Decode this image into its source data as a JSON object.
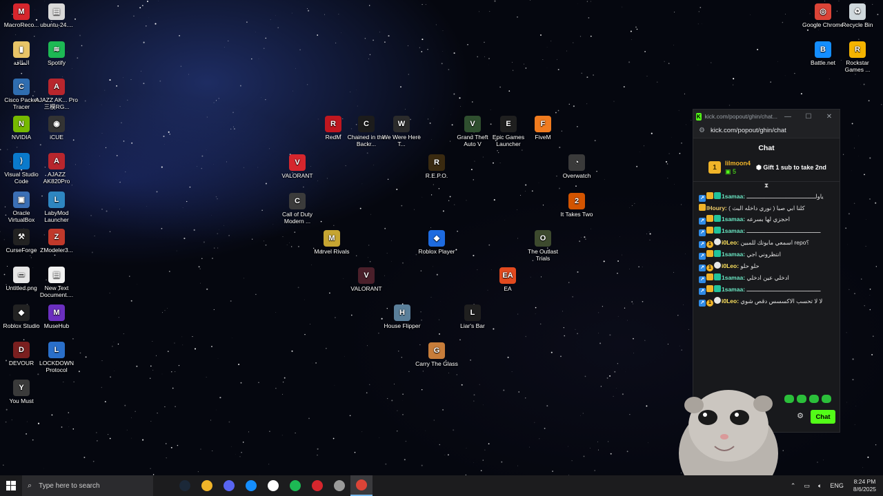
{
  "desktop_icons": [
    {
      "label": "MacroReco...",
      "color": "#d6262d",
      "glyph": "M"
    },
    {
      "label": "ubuntu-24....",
      "color": "#d9d9d9",
      "glyph": "▤"
    },
    {
      "label": "الطاقة",
      "color": "#e8c467",
      "glyph": "▮"
    },
    {
      "label": "Spotify",
      "color": "#1db954",
      "glyph": "≋"
    },
    {
      "label": "Cisco Packet Tracer",
      "color": "#2f6db0",
      "glyph": "C"
    },
    {
      "label": "AJAZZ AK... Pro三模RG...",
      "color": "#b8262d",
      "glyph": "A"
    },
    {
      "label": "NVIDIA",
      "color": "#76b900",
      "glyph": "N"
    },
    {
      "label": "iCUE",
      "color": "#333333",
      "glyph": "◉"
    },
    {
      "label": "Visual Studio Code",
      "color": "#0a7acc",
      "glyph": "⟩"
    },
    {
      "label": "AJAZZ AK820Pro",
      "color": "#b8262d",
      "glyph": "A"
    },
    {
      "label": "Oracle VirtualBox",
      "color": "#3b6fb5",
      "glyph": "▣"
    },
    {
      "label": "LabyMod Launcher",
      "color": "#2e86c1",
      "glyph": "L"
    },
    {
      "label": "CurseForge",
      "color": "#222222",
      "glyph": "⚒"
    },
    {
      "label": "ZModeler3...",
      "color": "#c0392b",
      "glyph": "Z"
    },
    {
      "label": "Untitled.png",
      "color": "#e6e6e6",
      "glyph": "▭"
    },
    {
      "label": "New Text Document....",
      "color": "#f2f2f2",
      "glyph": "▤"
    },
    {
      "label": "Roblox Studio",
      "color": "#222222",
      "glyph": "◆"
    },
    {
      "label": "MuseHub",
      "color": "#6b2fbf",
      "glyph": "M"
    },
    {
      "label": "DEVOUR",
      "color": "#7a1f1f",
      "glyph": "D"
    },
    {
      "label": "LOCKDOWN Protocol",
      "color": "#2a6fc9",
      "glyph": "L"
    },
    {
      "label": "You Must",
      "color": "#3a3a3a",
      "glyph": "Y"
    },
    {
      "label": "Google Chrome",
      "color": "#db4437",
      "glyph": "◎"
    },
    {
      "label": "Recycle Bin",
      "color": "#cfd8dc",
      "glyph": "♻"
    },
    {
      "label": "Battle.net",
      "color": "#148eff",
      "glyph": "B"
    },
    {
      "label": "Rockstar Games ...",
      "color": "#f5b400",
      "glyph": "R"
    },
    {
      "label": "RedM",
      "color": "#c0171f",
      "glyph": "R"
    },
    {
      "label": "Chained in the Backr...",
      "color": "#1c1c1c",
      "glyph": "C"
    },
    {
      "label": "We Were Here T...",
      "color": "#2b2b2b",
      "glyph": "W"
    },
    {
      "label": "Grand Theft Auto V",
      "color": "#2f4f2f",
      "glyph": "V"
    },
    {
      "label": "Epic Games Launcher",
      "color": "#1f1f1f",
      "glyph": "E"
    },
    {
      "label": "FiveM",
      "color": "#f07b1f",
      "glyph": "F"
    },
    {
      "label": "VALORANT",
      "color": "#d6262d",
      "glyph": "V"
    },
    {
      "label": "R.E.P.O.",
      "color": "#3a2a10",
      "glyph": "R"
    },
    {
      "label": "Overwatch",
      "color": "#3a3a3a",
      "glyph": "◔"
    },
    {
      "label": "Call of Duty Modern ...",
      "color": "#3b3b3b",
      "glyph": "C"
    },
    {
      "label": "It Takes Two",
      "color": "#d35400",
      "glyph": "2"
    },
    {
      "label": "Marvel Rivals",
      "color": "#c6a532",
      "glyph": "M"
    },
    {
      "label": "Roblox Player",
      "color": "#1e6be0",
      "glyph": "◆"
    },
    {
      "label": "The Outlast Trials",
      "color": "#3d4a2e",
      "glyph": "O"
    },
    {
      "label": "VALORANT",
      "color": "#4a1f2a",
      "glyph": "V"
    },
    {
      "label": "EA",
      "color": "#e24a1f",
      "glyph": "EA"
    },
    {
      "label": "House Flipper",
      "color": "#5a7f9a",
      "glyph": "H"
    },
    {
      "label": "Liar's Bar",
      "color": "#1f1f1f",
      "glyph": "L"
    },
    {
      "label": "Carry The Glass",
      "color": "#c77d3a",
      "glyph": "G"
    }
  ],
  "chat_window": {
    "title": "kick.com/popout/ghin/chat...",
    "url": "kick.com/popout/ghin/chat",
    "header": "Chat",
    "leaderboard": {
      "rank": "1",
      "name": "lilmoon4",
      "count": "5",
      "gift_text": "Gift 1 sub to take 2nd"
    },
    "messages": [
      {
        "user": "1samaa:",
        "text": "ياولــــــــــــــــــــــــــــــــــــــــ",
        "color": "u-green",
        "badges": [
          "blue",
          "gold",
          "green"
        ]
      },
      {
        "user": "lHoury:",
        "text": "كلنا ابي صبا ( نوري داخله البث )",
        "color": "u-gold",
        "badges": [
          "gold"
        ]
      },
      {
        "user": "1samaa:",
        "text": "احجزي لها بسرعه",
        "color": "u-green",
        "badges": [
          "blue",
          "gold",
          "green"
        ]
      },
      {
        "user": "1samaa:",
        "text": "ـــــــــــــــــــــــــــــــــــــــــــ",
        "color": "u-green",
        "badges": [
          "blue",
          "gold",
          "green"
        ]
      },
      {
        "user": "i0Leo:",
        "text": "اسمعي مابوتك للمبين repo؟",
        "color": "u-yellow",
        "badges": [
          "blue",
          "num",
          "white"
        ]
      },
      {
        "user": "1samaa:",
        "text": "انتظروني اجي",
        "color": "u-green",
        "badges": [
          "blue",
          "gold",
          "green"
        ]
      },
      {
        "user": "i0Leo:",
        "text": "حلو حلو",
        "color": "u-yellow",
        "badges": [
          "blue",
          "num",
          "white"
        ]
      },
      {
        "user": "1samaa:",
        "text": "ادخلي عين ادخلي",
        "color": "u-green",
        "badges": [
          "blue",
          "gold",
          "green"
        ]
      },
      {
        "user": "1samaa:",
        "text": "ـــــــــــــــــــــــــــــــــــــــــــ",
        "color": "u-green",
        "badges": [
          "blue",
          "gold",
          "green"
        ]
      },
      {
        "user": "i0Leo:",
        "text": "لا لا تحسب الاكسسس دقص شوي",
        "color": "u-yellow",
        "badges": [
          "blue",
          "num",
          "white"
        ]
      }
    ],
    "chat_button": "Chat"
  },
  "taskbar": {
    "search_placeholder": "Type here to search",
    "language": "ENG",
    "time": "8:24 PM",
    "date": "8/6/2025",
    "pinned": [
      {
        "name": "steam",
        "color": "#1b2838"
      },
      {
        "name": "app-yellow",
        "color": "#f0b429"
      },
      {
        "name": "discord",
        "color": "#5865f2"
      },
      {
        "name": "battle-net",
        "color": "#148eff"
      },
      {
        "name": "steelseries",
        "color": "#ffffff"
      },
      {
        "name": "spotify",
        "color": "#1db954"
      },
      {
        "name": "ajazz",
        "color": "#d6262d"
      },
      {
        "name": "app-circle",
        "color": "#9a9a9a"
      },
      {
        "name": "chrome",
        "color": "#db4437"
      }
    ]
  }
}
